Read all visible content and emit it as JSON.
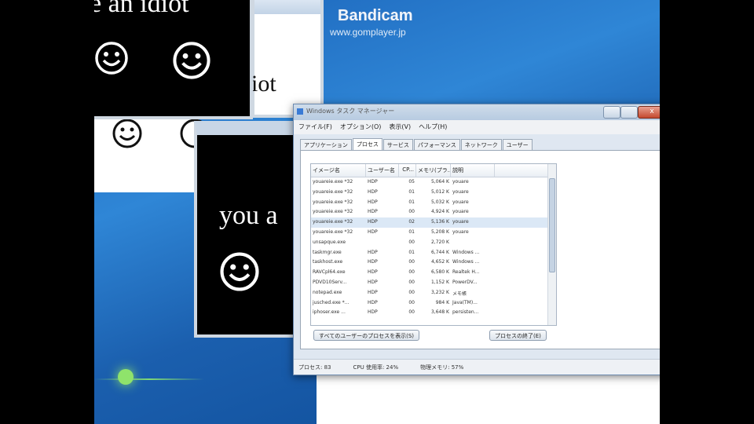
{
  "watermark": {
    "title": "Bandicam",
    "url": "www.gomplayer.jp"
  },
  "popups": {
    "main_text": "e an idiot",
    "back_text": "iot",
    "front_text": "you a"
  },
  "task_manager": {
    "title": "Windows タスク マネージャー",
    "controls": {
      "close": "x"
    },
    "menu": [
      "ファイル(F)",
      "オプション(O)",
      "表示(V)",
      "ヘルプ(H)"
    ],
    "tabs": [
      "アプリケーション",
      "プロセス",
      "サービス",
      "パフォーマンス",
      "ネットワーク",
      "ユーザー"
    ],
    "columns": [
      "イメージ名",
      "ユーザー名",
      "CP...",
      "メモリ(プラ...",
      "説明"
    ],
    "rows": [
      [
        "youareie.exe *32",
        "HDP",
        "05",
        "5,064 K",
        "youare"
      ],
      [
        "youareie.exe *32",
        "HDP",
        "01",
        "5,012 K",
        "youare"
      ],
      [
        "youareie.exe *32",
        "HDP",
        "01",
        "5,032 K",
        "youare"
      ],
      [
        "youareie.exe *32",
        "HDP",
        "00",
        "4,924 K",
        "youare"
      ],
      [
        "youareie.exe *32",
        "HDP",
        "02",
        "5,136 K",
        "youare"
      ],
      [
        "youareie.exe *32",
        "HDP",
        "01",
        "5,208 K",
        "youare"
      ],
      [
        "unsapque.exe",
        "",
        "00",
        "2,720 K",
        ""
      ],
      [
        "taskmgr.exe",
        "HDP",
        "01",
        "6,744 K",
        "Windows ..."
      ],
      [
        "taskhost.exe",
        "HDP",
        "00",
        "4,652 K",
        "Windows ..."
      ],
      [
        "RAVCpl64.exe",
        "HDP",
        "00",
        "6,580 K",
        "Realtek H..."
      ],
      [
        "PDVD10Serv...",
        "HDP",
        "00",
        "1,152 K",
        "PowerDV..."
      ],
      [
        "notepad.exe",
        "HDP",
        "00",
        "3,232 K",
        "メモ帳"
      ],
      [
        "jusched.exe *...",
        "HDP",
        "00",
        "984 K",
        "Java(TM)..."
      ],
      [
        "iphoser.exe ...",
        "HDP",
        "00",
        "3,648 K",
        "persisten..."
      ]
    ],
    "selected_row": 4,
    "show_all_button": "すべてのユーザーのプロセスを表示(S)",
    "end_process_button": "プロセスの終了(E)",
    "status": {
      "processes": "プロセス: 83",
      "cpu": "CPU 使用率: 24%",
      "memory": "物理メモリ: 57%"
    }
  }
}
